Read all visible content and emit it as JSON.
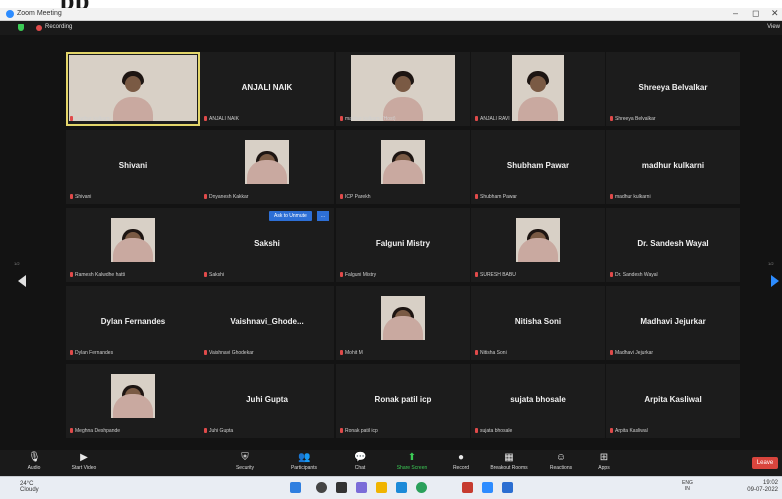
{
  "banner": {
    "text": "pp"
  },
  "window": {
    "title": "Zoom Meeting",
    "minimize": "–",
    "maximize": "◻",
    "close": "✕"
  },
  "meeting_bar": {
    "recording": "Recording",
    "view": "View"
  },
  "chip": {
    "label": "Ask to Unmute",
    "extra": "..."
  },
  "tiles": [
    {
      "row": 0,
      "col": 0,
      "name": "",
      "label": "madhur kulkarni",
      "video": true,
      "active": true
    },
    {
      "row": 0,
      "col": 1,
      "name": "ANJALI NAIK",
      "label": "ANJALI NAIK"
    },
    {
      "row": 0,
      "col": 2,
      "name": "",
      "label": "madhur kulkarni (Host)",
      "video": true
    },
    {
      "row": 0,
      "col": 3,
      "name": "",
      "label": "ANJALI RAVI",
      "video": true
    },
    {
      "row": 0,
      "col": 4,
      "name": "Shreeya Belvalkar",
      "label": "Shreeya Belvalkar"
    },
    {
      "row": 1,
      "col": 0,
      "name": "Shivani",
      "label": "Shivani"
    },
    {
      "row": 1,
      "col": 1,
      "name": "",
      "label": "Dnyanesh Kakkar",
      "video": true
    },
    {
      "row": 1,
      "col": 2,
      "name": "",
      "label": "ICP Parekh",
      "video": true
    },
    {
      "row": 1,
      "col": 3,
      "name": "Shubham Pawar",
      "label": "Shubham Pawar"
    },
    {
      "row": 1,
      "col": 4,
      "name": "madhur kulkarni",
      "label": "madhur kulkarni"
    },
    {
      "row": 2,
      "col": 0,
      "name": "",
      "label": "Ramesh Kalwdhe hatti",
      "video": true
    },
    {
      "row": 2,
      "col": 1,
      "name": "Sakshi",
      "label": "Sakshi"
    },
    {
      "row": 2,
      "col": 2,
      "name": "Falguni Mistry",
      "label": "Falguni Mistry"
    },
    {
      "row": 2,
      "col": 3,
      "name": "",
      "label": "SURESH BABU",
      "video": true
    },
    {
      "row": 2,
      "col": 4,
      "name": "Dr. Sandesh Wayal",
      "label": "Dr. Sandesh Wayal"
    },
    {
      "row": 3,
      "col": 0,
      "name": "Dylan Fernandes",
      "label": "Dylan Fernandes"
    },
    {
      "row": 3,
      "col": 1,
      "name": "Vaishnavi_Ghode...",
      "label": "Vaishnavi Ghodekar"
    },
    {
      "row": 3,
      "col": 2,
      "name": "",
      "label": "Mohit M",
      "video": true
    },
    {
      "row": 3,
      "col": 3,
      "name": "Nitisha Soni",
      "label": "Nitisha Soni"
    },
    {
      "row": 3,
      "col": 4,
      "name": "Madhavi Jejurkar",
      "label": "Madhavi Jejurkar"
    },
    {
      "row": 4,
      "col": 0,
      "name": "",
      "label": "Meghna Deshpande",
      "video": true
    },
    {
      "row": 4,
      "col": 1,
      "name": "Juhi Gupta",
      "label": "Juhi Gupta"
    },
    {
      "row": 4,
      "col": 2,
      "name": "Ronak patil icp",
      "label": "Ronak patil icp"
    },
    {
      "row": 4,
      "col": 3,
      "name": "sujata bhosale",
      "label": "sujata bhosale"
    },
    {
      "row": 4,
      "col": 4,
      "name": "Arpita Kasliwal",
      "label": "Arpita Kasliwal"
    }
  ],
  "pages": {
    "left": "1/2",
    "right": "1/2"
  },
  "toolbar": {
    "audio": "Audio",
    "video": "Start Video",
    "security": "Security",
    "participants": "Participants",
    "participants_count": "35",
    "chat": "Chat",
    "share": "Share Screen",
    "record": "Record",
    "breakout": "Breakout Rooms",
    "reactions": "Reactions",
    "apps": "Apps",
    "leave": "Leave"
  },
  "taskbar": {
    "temp": "24°C",
    "weather": "Cloudy",
    "lang_top": "ENG",
    "lang_bottom": "IN",
    "time": "19:02",
    "date": "09-07-2022"
  },
  "colors": {
    "accent": "#2d8cff",
    "active_speaker": "#e3d56a",
    "leave": "#d9453d",
    "share": "#3ccb56"
  }
}
